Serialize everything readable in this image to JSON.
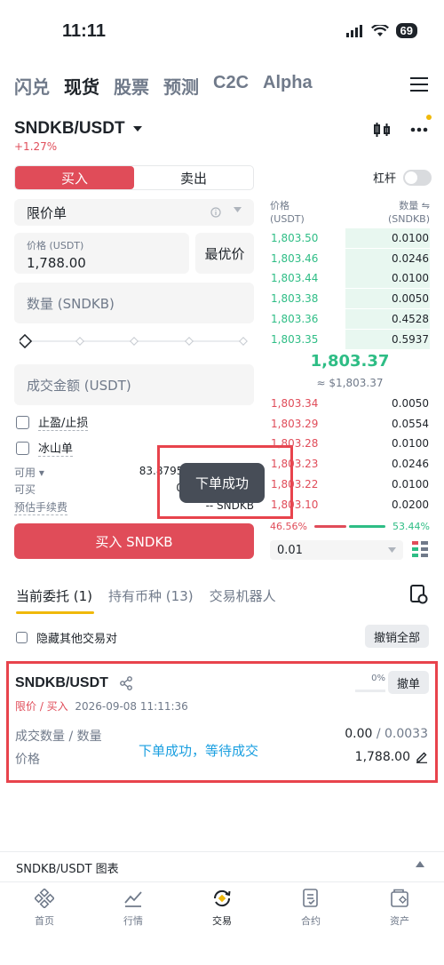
{
  "status": {
    "time": "11:11",
    "battery": "69"
  },
  "nav": {
    "items": [
      "闪兑",
      "现货",
      "股票",
      "预测",
      "C2C",
      "Alpha"
    ],
    "active": 1
  },
  "pair": {
    "symbol": "SNDKB/USDT",
    "change": "+1.27%"
  },
  "trade": {
    "buy_label": "买入",
    "sell_label": "卖出",
    "leverage_label": "杠杆",
    "order_type": "限价单",
    "price_label": "价格 (USDT)",
    "price_value": "1,788.00",
    "best_price_label": "最优价",
    "qty_placeholder": "数量 (SNDKB)",
    "amount_placeholder": "成交金额 (USDT)",
    "tpsl_label": "止盈/止损",
    "iceberg_label": "冰山单",
    "available_label": "可用",
    "available_value": "83.87955",
    "canbuy_label": "可买",
    "canbuy_value": "0",
    "fee_label": "预估手续费",
    "fee_value": "-- SNDKB",
    "submit_label": "买入 SNDKB"
  },
  "orderbook": {
    "price_header": "价格",
    "price_unit": "(USDT)",
    "qty_header": "数量 ⇋",
    "qty_unit": "(SNDKB)",
    "asks": [
      {
        "price": "1,803.50",
        "qty": "0.0100",
        "depth": 0.53
      },
      {
        "price": "1,803.46",
        "qty": "0.0246",
        "depth": 0.53
      },
      {
        "price": "1,803.44",
        "qty": "0.0100",
        "depth": 0.53
      },
      {
        "price": "1,803.38",
        "qty": "0.0050",
        "depth": 0.53
      },
      {
        "price": "1,803.36",
        "qty": "0.4528",
        "depth": 0.53
      },
      {
        "price": "1,803.35",
        "qty": "0.5937",
        "depth": 0.53
      }
    ],
    "mid_price": "1,803.37",
    "mid_usd": "≈ $1,803.37",
    "bids": [
      {
        "price": "1,803.34",
        "qty": "0.0050",
        "depth": 0.0
      },
      {
        "price": "1,803.29",
        "qty": "0.0554",
        "depth": 0.0
      },
      {
        "price": "1,803.28",
        "qty": "0.0100",
        "depth": 0.0
      },
      {
        "price": "1,803.23",
        "qty": "0.0246",
        "depth": 0.0
      },
      {
        "price": "1,803.22",
        "qty": "0.0100",
        "depth": 0.0
      },
      {
        "price": "1,803.10",
        "qty": "0.0200",
        "depth": 0.0
      }
    ],
    "buy_ratio": "46.56%",
    "sell_ratio": "53.44%",
    "precision": "0.01"
  },
  "toast": "下单成功",
  "tabs": {
    "items": [
      "当前委托 (1)",
      "持有币种 (13)",
      "交易机器人"
    ],
    "active": 0
  },
  "hide_others_label": "隐藏其他交易对",
  "cancel_all_label": "撤销全部",
  "order": {
    "symbol": "SNDKB/USDT",
    "type": "限价 / 买入",
    "time": "2026-09-08 11:11:36",
    "progress": "0%",
    "cancel_label": "撤单",
    "qty_label": "成交数量 / 数量",
    "price_label": "价格",
    "filled": "0.00",
    "total": " / 0.0033",
    "price": "1,788.00"
  },
  "overlay_message": "下单成功，等待成交",
  "chart_label": "SNDKB/USDT 图表",
  "tabbar": [
    "首页",
    "行情",
    "交易",
    "合约",
    "资产"
  ],
  "colors": {
    "red": "#e04c59",
    "green": "#2ebd85",
    "yellow": "#f0b90b",
    "annotation": "#e8434c",
    "blue_text": "#1a9fe0"
  }
}
